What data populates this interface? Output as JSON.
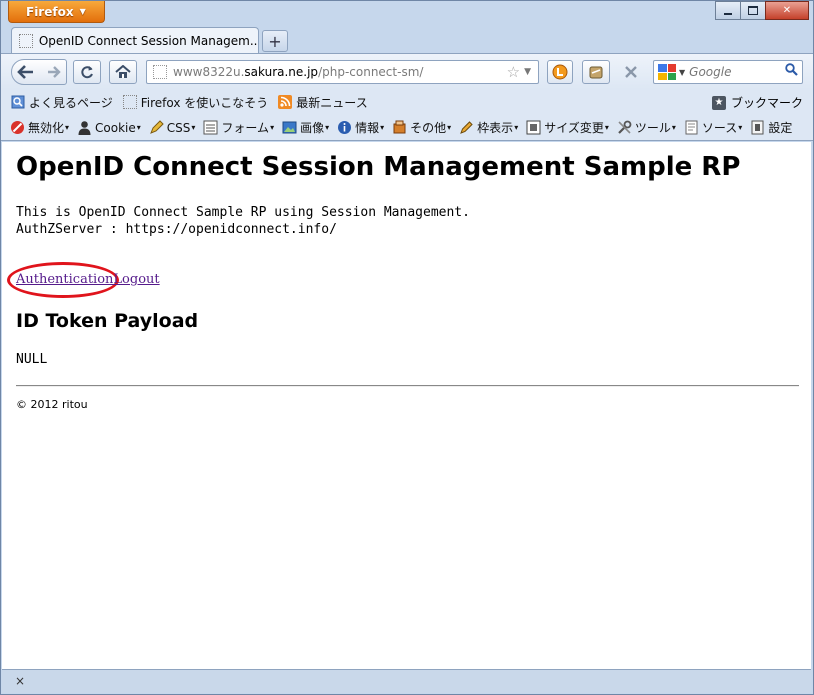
{
  "browser": {
    "app_button": "Firefox",
    "tab_title": "OpenID Connect Session Managem...",
    "url_prefix": "www8322u.",
    "url_host": "sakura.ne.jp",
    "url_path": "/php-connect-sm/",
    "search_placeholder": "Google"
  },
  "bookmarks": {
    "items": [
      "よく見るページ",
      "Firefox を使いこなそう",
      "最新ニュース"
    ],
    "right": "ブックマーク"
  },
  "devbar": {
    "items": [
      "無効化",
      "Cookie",
      "CSS",
      "フォーム",
      "画像",
      "情報",
      "その他",
      "枠表示",
      "サイズ変更",
      "ツール",
      "ソース",
      "設定"
    ]
  },
  "page": {
    "title": "OpenID Connect Session Management Sample RP",
    "line1": "This is OpenID Connect Sample RP using Session Management.",
    "line2": "AuthZServer : https://openidconnect.info/",
    "link_auth": "Authentication",
    "link_logout": "Logout",
    "h2": "ID Token Payload",
    "payload": "NULL",
    "footer": "© 2012 ritou"
  },
  "status": {
    "close_glyph": "×"
  },
  "colors": {
    "firefox_orange": "#e36f0c",
    "link_visited": "#551a8b",
    "annotation_red": "#e0141c"
  }
}
